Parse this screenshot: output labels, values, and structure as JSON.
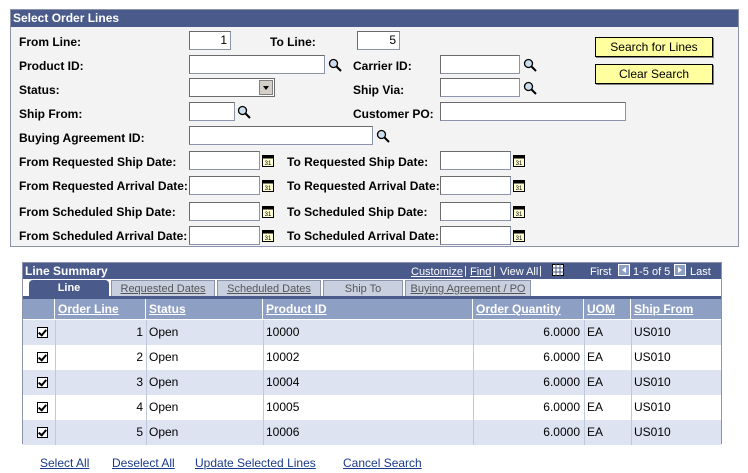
{
  "select_order_lines": {
    "title": "Select Order Lines",
    "from_line_label": "From Line:",
    "from_line_value": "1",
    "to_line_label": "To Line:",
    "to_line_value": "5",
    "product_id_label": "Product ID:",
    "carrier_id_label": "Carrier ID:",
    "status_label": "Status:",
    "ship_via_label": "Ship Via:",
    "ship_from_label": "Ship From:",
    "customer_po_label": "Customer PO:",
    "buying_agreement_label": "Buying Agreement ID:",
    "from_req_ship_label": "From Requested Ship Date:",
    "to_req_ship_label": "To Requested Ship Date:",
    "from_req_arrival_label": "From Requested Arrival Date:",
    "to_req_arrival_label": "To Requested Arrival Date:",
    "from_sched_ship_label": "From Scheduled Ship Date:",
    "to_sched_ship_label": "To Scheduled Ship Date:",
    "from_sched_arrival_label": "From Scheduled Arrival Date:",
    "to_sched_arrival_label": "To Scheduled Arrival Date:",
    "search_button": "Search for Lines",
    "clear_button": "Clear Search"
  },
  "line_summary": {
    "title": "Line Summary",
    "customize": "Customize",
    "find": "Find",
    "view_all": "View All",
    "first": "First",
    "range": "1-5 of 5",
    "last": "Last",
    "tabs": [
      "Line",
      "Requested Dates",
      "Scheduled Dates",
      "Ship To",
      "Buying Agreement / PO"
    ],
    "columns": [
      "Order Line",
      "Status",
      "Product ID",
      "Order Quantity",
      "UOM",
      "Ship From"
    ],
    "rows": [
      {
        "line": "1",
        "status": "Open",
        "product": "10000",
        "qty": "6.0000",
        "uom": "EA",
        "ship_from": "US010"
      },
      {
        "line": "2",
        "status": "Open",
        "product": "10002",
        "qty": "6.0000",
        "uom": "EA",
        "ship_from": "US010"
      },
      {
        "line": "3",
        "status": "Open",
        "product": "10004",
        "qty": "6.0000",
        "uom": "EA",
        "ship_from": "US010"
      },
      {
        "line": "4",
        "status": "Open",
        "product": "10005",
        "qty": "6.0000",
        "uom": "EA",
        "ship_from": "US010"
      },
      {
        "line": "5",
        "status": "Open",
        "product": "10006",
        "qty": "6.0000",
        "uom": "EA",
        "ship_from": "US010"
      }
    ]
  },
  "footer": {
    "select_all": "Select All",
    "deselect_all": "Deselect All",
    "update_selected": "Update Selected Lines",
    "cancel_search": "Cancel Search"
  },
  "colors": {
    "header_bg": "#4a5a8a",
    "button_bg": "#ffffa0",
    "row_alt": "#dde3f1"
  }
}
